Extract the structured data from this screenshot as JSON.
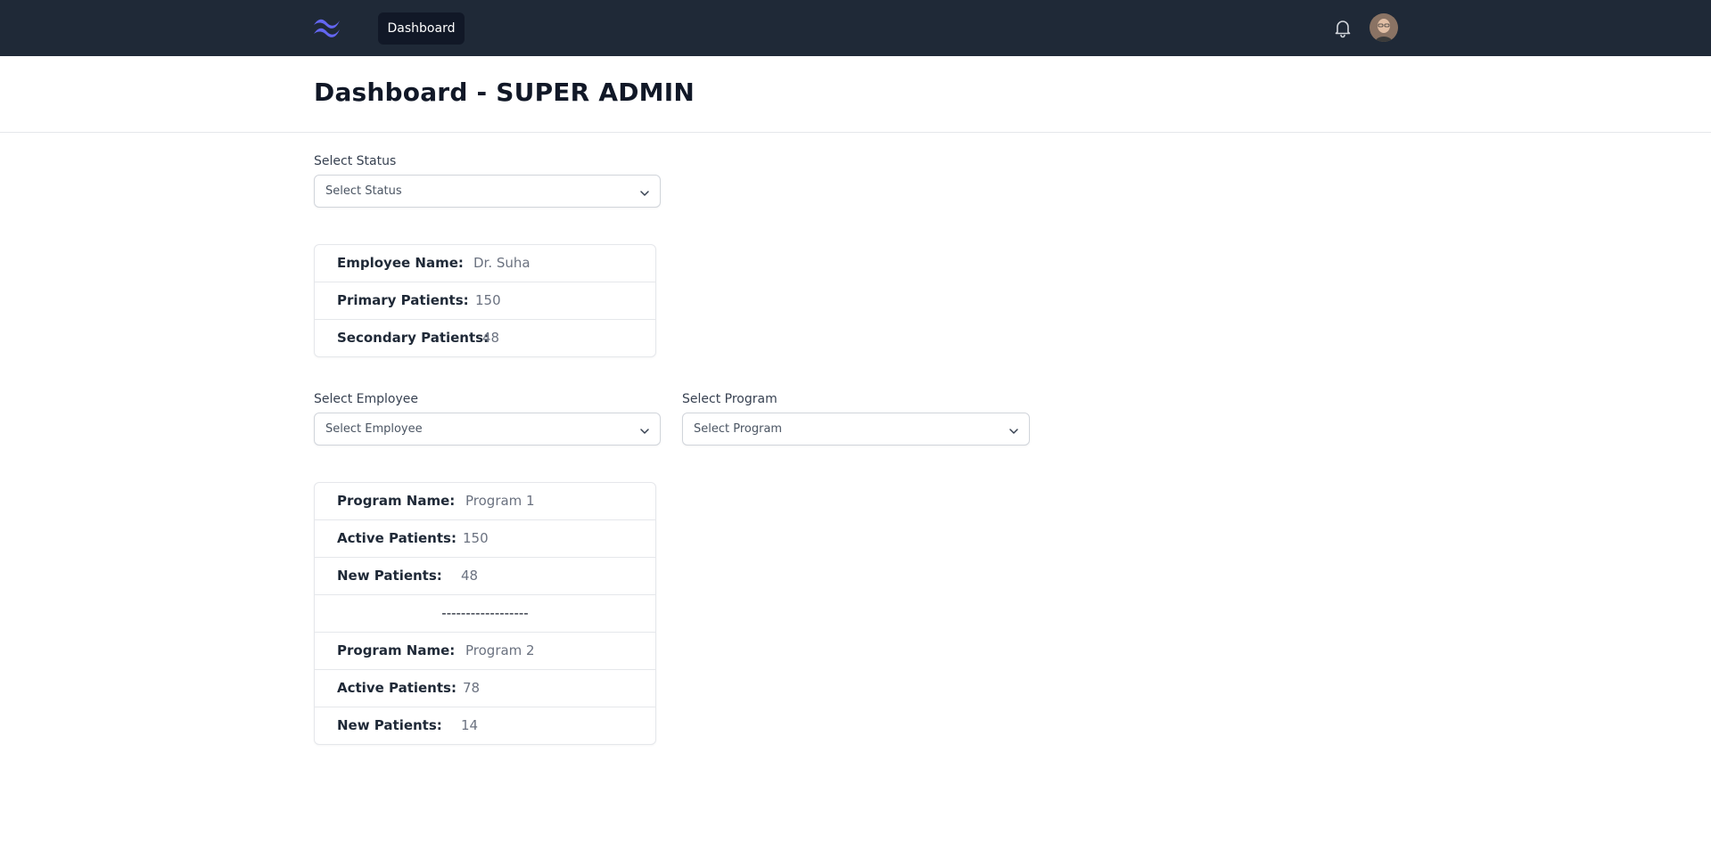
{
  "nav": {
    "logo_icon": "tailwind-wave-logo",
    "dashboard_label": "Dashboard",
    "bell_icon": "bell-icon",
    "avatar_icon": "user-avatar"
  },
  "page": {
    "title": "Dashboard - SUPER ADMIN"
  },
  "status_filter": {
    "label": "Select Status",
    "value": "Select Status"
  },
  "employee_card": {
    "rows": [
      {
        "label": "Employee Name:",
        "value": "Dr. Suha"
      },
      {
        "label": "Primary Patients:",
        "value": "150"
      },
      {
        "label": "Secondary Patients:",
        "value": "48"
      }
    ]
  },
  "employee_filter": {
    "label": "Select Employee",
    "value": "Select Employee"
  },
  "program_filter": {
    "label": "Select Program",
    "value": "Select Program"
  },
  "programs_card": {
    "separator": "------------------",
    "programs": [
      {
        "name_label": "Program Name:",
        "name": "Program 1",
        "active_label": "Active Patients:",
        "active": "150",
        "new_label": "New Patients:",
        "new": "48"
      },
      {
        "name_label": "Program Name:",
        "name": "Program 2",
        "active_label": "Active Patients:",
        "active": "78",
        "new_label": "New Patients:",
        "new": "14"
      }
    ]
  },
  "colors": {
    "navbar_bg": "#1f2937",
    "logo_accent": "#6366f1",
    "nav_active_bg": "#111827"
  }
}
